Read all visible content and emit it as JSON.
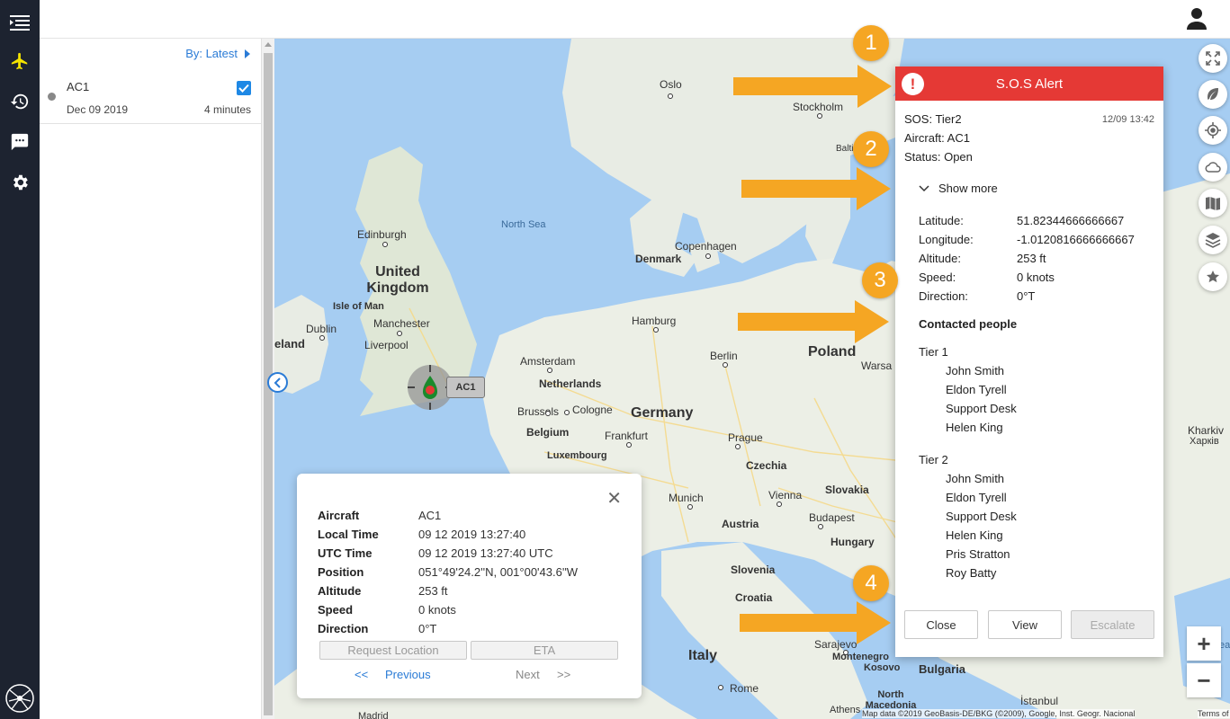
{
  "nav": {
    "items": [
      {
        "name": "menu-icon",
        "active": false
      },
      {
        "name": "aircraft-icon",
        "active": true
      },
      {
        "name": "history-icon",
        "active": false
      },
      {
        "name": "messages-icon",
        "active": false
      },
      {
        "name": "settings-icon",
        "active": false
      }
    ],
    "logo": "spider-logo-icon"
  },
  "list": {
    "sort_label": "By: Latest",
    "items": [
      {
        "name": "AC1",
        "date": "Dec 09 2019",
        "duration": "4 minutes",
        "checked": true
      }
    ]
  },
  "map": {
    "labels": {
      "oslo": "Oslo",
      "stockholm": "Stockholm",
      "baltic": "Balti",
      "north_sea": "North Sea",
      "edinburgh": "Edinburgh",
      "denmark": "Denmark",
      "copenhagen": "Copenhagen",
      "uk": "United Kingdom",
      "isle_of_man": "Isle of Man",
      "manchester": "Manchester",
      "dublin": "Dublin",
      "liverpool": "Liverpool",
      "ireland": "eland",
      "hamburg": "Hamburg",
      "poland": "Poland",
      "berlin": "Berlin",
      "warsaw": "Warsa",
      "amsterdam": "Amsterdam",
      "netherlands": "Netherlands",
      "brussels": "Brussels",
      "cologne": "Cologne",
      "belgium": "Belgium",
      "frankfurt": "Frankfurt",
      "germany": "Germany",
      "luxembourg": "Luxembourg",
      "prague": "Prague",
      "czechia": "Czechia",
      "munich": "Munich",
      "vienna": "Vienna",
      "slovakia": "Slovakia",
      "austria": "Austria",
      "budapest": "Budapest",
      "hungary": "Hungary",
      "slovenia": "Slovenia",
      "croatia": "Croatia",
      "sarajevo": "Sarajevo",
      "montenegro": "Montenegro",
      "italy": "Italy",
      "rome": "Rome",
      "kosovo": "Kosovo",
      "north_macedonia": "North Macedonia",
      "bulgaria": "Bulgaria",
      "istanbul": "İstanbul",
      "kharkiv": "Kharkiv",
      "kharkiv_local": "Харків",
      "madrid": "Madrid",
      "athens": "Athens",
      "sea_partial": "ea"
    },
    "aircraft_tag": "AC1",
    "attribution": "Map data ©2019 GeoBasis-DE/BKG (©2009), Google, Inst. Geogr. Nacional",
    "terms": "Terms of Use",
    "tools": [
      "fullscreen-icon",
      "leaf-icon",
      "locate-icon",
      "cloud-icon",
      "map-icon",
      "layers-icon",
      "star-icon"
    ],
    "zoom_in": "+",
    "zoom_out": "−"
  },
  "popup": {
    "rows": [
      {
        "k": "Aircraft",
        "v": "AC1"
      },
      {
        "k": "Local Time",
        "v": "09 12 2019 13:27:40"
      },
      {
        "k": "UTC Time",
        "v": "09 12 2019 13:27:40 UTC"
      },
      {
        "k": "Position",
        "v": "051°49'24.2''N, 001°00'43.6''W"
      },
      {
        "k": "Altitude",
        "v": "253 ft"
      },
      {
        "k": "Speed",
        "v": "0 knots"
      },
      {
        "k": "Direction",
        "v": "0°T"
      }
    ],
    "request_location": "Request Location",
    "eta": "ETA",
    "prev_arrows": "<<",
    "previous": "Previous",
    "next": "Next",
    "next_arrows": ">>"
  },
  "sos": {
    "title": "S.O.S Alert",
    "alert_glyph": "!",
    "sos_line": "SOS: Tier2",
    "aircraft_line": "Aircraft: AC1",
    "status_line": "Status: Open",
    "timestamp": "12/09 13:42",
    "show_more": "Show more",
    "details": [
      {
        "k": "Latitude:",
        "v": "51.82344666666667"
      },
      {
        "k": "Longitude:",
        "v": "-1.0120816666666667"
      },
      {
        "k": "Altitude:",
        "v": "253 ft"
      },
      {
        "k": "Speed:",
        "v": "0 knots"
      },
      {
        "k": "Direction:",
        "v": "0°T"
      }
    ],
    "contacted_title": "Contacted people",
    "tier1_label": "Tier 1",
    "tier1": [
      "John Smith",
      "Eldon Tyrell",
      "Support Desk",
      "Helen King"
    ],
    "tier2_label": "Tier 2",
    "tier2": [
      "John Smith",
      "Eldon Tyrell",
      "Support Desk",
      "Helen King",
      "Pris Stratton",
      "Roy Batty"
    ],
    "close": "Close",
    "view": "View",
    "escalate": "Escalate"
  },
  "annotations": [
    "1",
    "2",
    "3",
    "4"
  ],
  "colors": {
    "nav_bg": "#1d2330",
    "accent": "#f5e400",
    "alert": "#e53935",
    "badge": "#f5a623",
    "link": "#2a7bd6"
  }
}
